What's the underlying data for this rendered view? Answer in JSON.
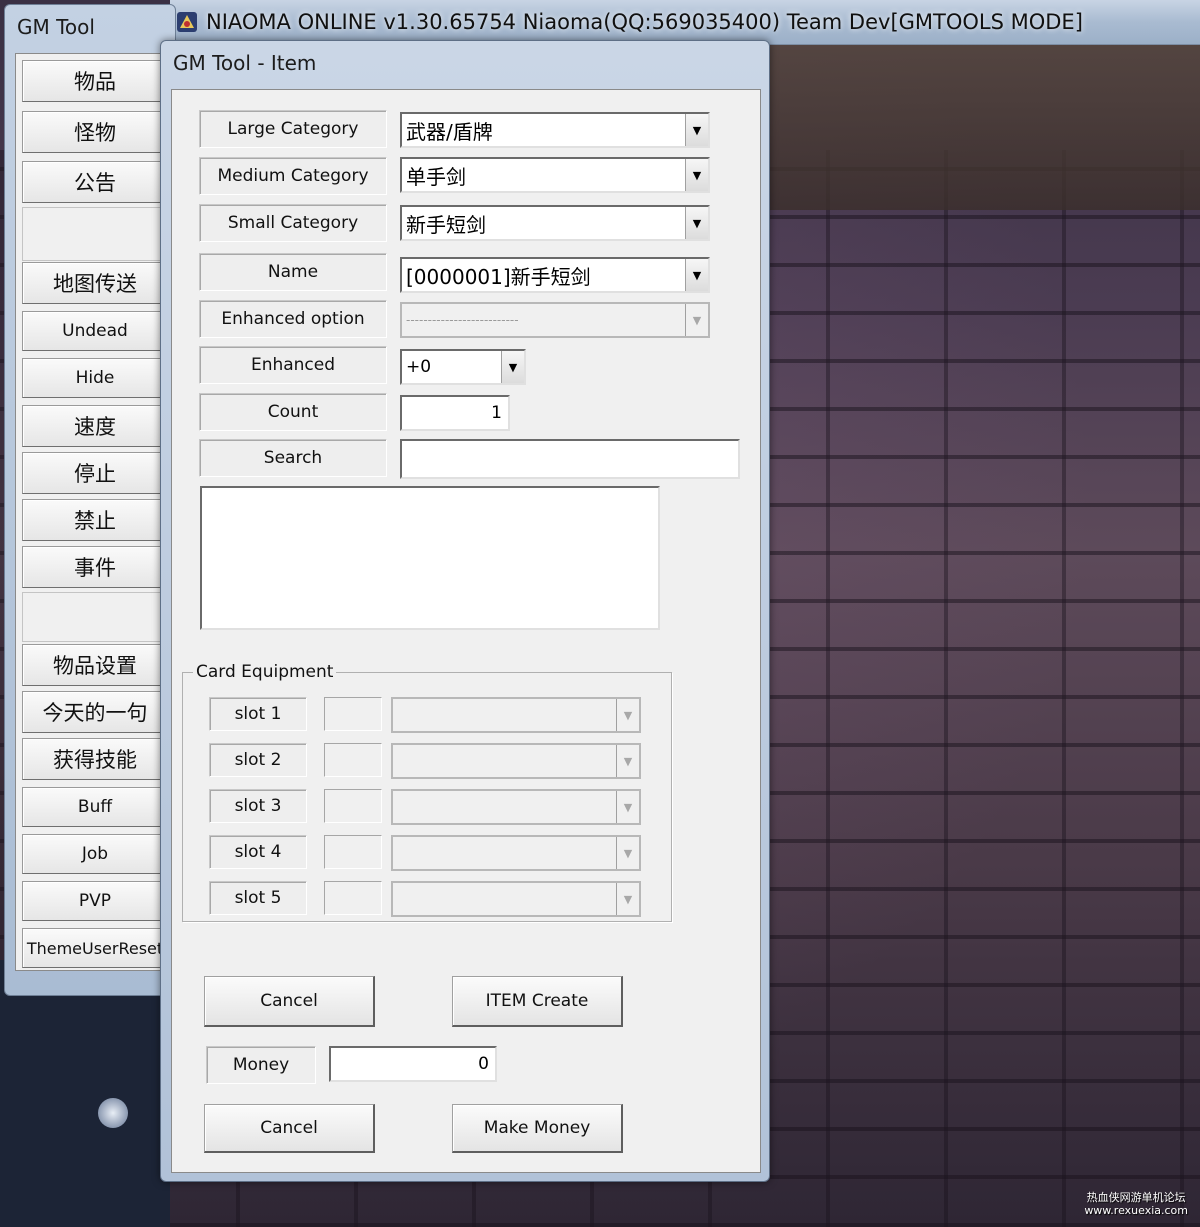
{
  "main_window": {
    "title": "NIAOMA ONLINE  v1.30.65754 Niaoma(QQ:569035400) Team Dev[GMTOOLS MODE]"
  },
  "gm_tool": {
    "title": "GM Tool",
    "menu": [
      "物品",
      "怪物",
      "公告",
      "",
      "地图传送",
      "Undead",
      "Hide",
      "速度",
      "停止",
      "禁止",
      "事件",
      "",
      "物品设置",
      "今天的一句",
      "获得技能",
      "Buff",
      "Job",
      "PVP",
      "ThemeUserReset"
    ]
  },
  "item_dialog": {
    "title": "GM Tool - Item",
    "large_category": {
      "label": "Large Category",
      "value": "武器/盾牌"
    },
    "medium_category": {
      "label": "Medium Category",
      "value": "单手剑"
    },
    "small_category": {
      "label": "Small Category",
      "value": "新手短剑"
    },
    "name": {
      "label": "Name",
      "value": "[0000001]新手短剑"
    },
    "enhanced_option": {
      "label": "Enhanced option",
      "value": "--------------------------"
    },
    "enhanced": {
      "label": "Enhanced",
      "value": "+0"
    },
    "count": {
      "label": "Count",
      "value": "1"
    },
    "search": {
      "label": "Search",
      "value": ""
    },
    "card_equipment": {
      "legend": "Card Equipment",
      "slots": [
        "slot 1",
        "slot 2",
        "slot 3",
        "slot 4",
        "slot 5"
      ]
    },
    "cancel_label": "Cancel",
    "item_create_label": "ITEM Create",
    "money": {
      "label": "Money",
      "value": "0"
    },
    "cancel2_label": "Cancel",
    "make_money_label": "Make Money"
  },
  "watermark": {
    "line1": "热血侠网游单机论坛",
    "line2": "www.rexuexia.com"
  }
}
